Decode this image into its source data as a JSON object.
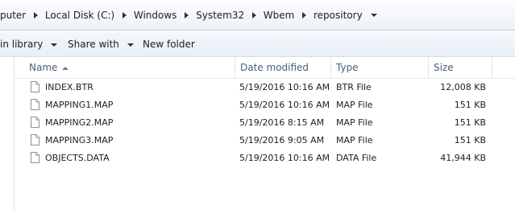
{
  "breadcrumb": [
    "puter",
    "Local Disk (C:)",
    "Windows",
    "System32",
    "Wbem",
    "repository"
  ],
  "toolbar": {
    "include_label": "in library",
    "share_label": "Share with",
    "new_folder_label": "New folder"
  },
  "columns": {
    "name": "Name",
    "date": "Date modified",
    "type": "Type",
    "size": "Size"
  },
  "files": [
    {
      "name": "INDEX.BTR",
      "date": "5/19/2016 10:16 AM",
      "type": "BTR File",
      "size": "12,008 KB"
    },
    {
      "name": "MAPPING1.MAP",
      "date": "5/19/2016 10:16 AM",
      "type": "MAP File",
      "size": "151 KB"
    },
    {
      "name": "MAPPING2.MAP",
      "date": "5/19/2016 8:15 AM",
      "type": "MAP File",
      "size": "151 KB"
    },
    {
      "name": "MAPPING3.MAP",
      "date": "5/19/2016 9:05 AM",
      "type": "MAP File",
      "size": "151 KB"
    },
    {
      "name": "OBJECTS.DATA",
      "date": "5/19/2016 10:16 AM",
      "type": "DATA File",
      "size": "41,944 KB"
    }
  ],
  "icons": {
    "file": "document-icon",
    "separator": "chevron-right-icon",
    "dropdown": "dropdown-arrow-icon",
    "sort": "sort-ascending-icon"
  }
}
